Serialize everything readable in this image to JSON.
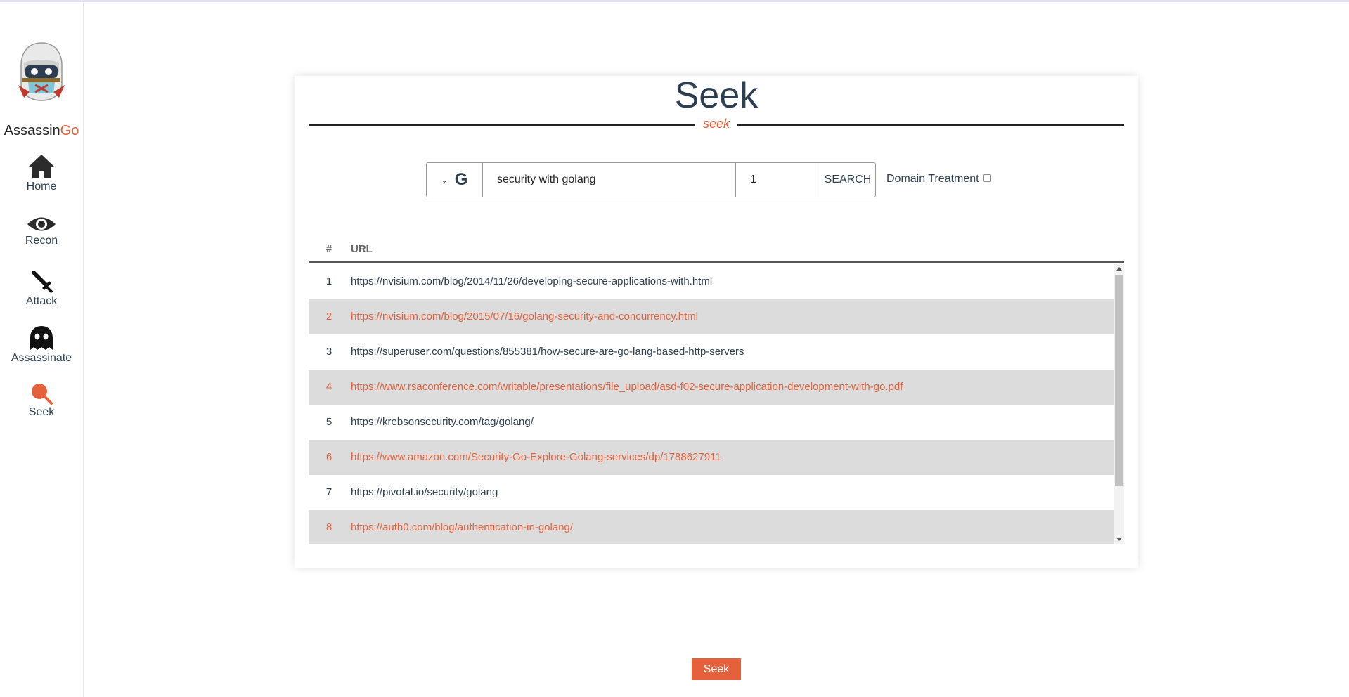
{
  "brand": {
    "name_main": "Assassin",
    "name_accent": "Go",
    "accent_color": "#e5613b"
  },
  "sidebar": {
    "items": [
      {
        "label": "Home",
        "icon": "home-icon"
      },
      {
        "label": "Recon",
        "icon": "eye-icon"
      },
      {
        "label": "Attack",
        "icon": "sword-icon"
      },
      {
        "label": "Assassinate",
        "icon": "ghost-icon"
      },
      {
        "label": "Seek",
        "icon": "search-icon",
        "active": true
      }
    ]
  },
  "page": {
    "title": "Seek",
    "subtitle": "seek"
  },
  "search": {
    "engine": "G",
    "query": "security with golang",
    "pages": "1",
    "button_label": "SEARCH",
    "domain_label": "Domain Treatment",
    "domain_checked": false
  },
  "table": {
    "headers": {
      "num": "#",
      "url": "URL"
    },
    "rows": [
      {
        "num": "1",
        "url": "https://nvisium.com/blog/2014/11/26/developing-secure-applications-with.html"
      },
      {
        "num": "2",
        "url": "https://nvisium.com/blog/2015/07/16/golang-security-and-concurrency.html"
      },
      {
        "num": "3",
        "url": "https://superuser.com/questions/855381/how-secure-are-go-lang-based-http-servers"
      },
      {
        "num": "4",
        "url": "https://www.rsaconference.com/writable/presentations/file_upload/asd-f02-secure-application-development-with-go.pdf"
      },
      {
        "num": "5",
        "url": "https://krebsonsecurity.com/tag/golang/"
      },
      {
        "num": "6",
        "url": "https://www.amazon.com/Security-Go-Explore-Golang-services/dp/1788627911"
      },
      {
        "num": "7",
        "url": "https://pivotal.io/security/golang"
      },
      {
        "num": "8",
        "url": "https://auth0.com/blog/authentication-in-golang/"
      }
    ]
  },
  "footer": {
    "seek_button_label": "Seek"
  }
}
